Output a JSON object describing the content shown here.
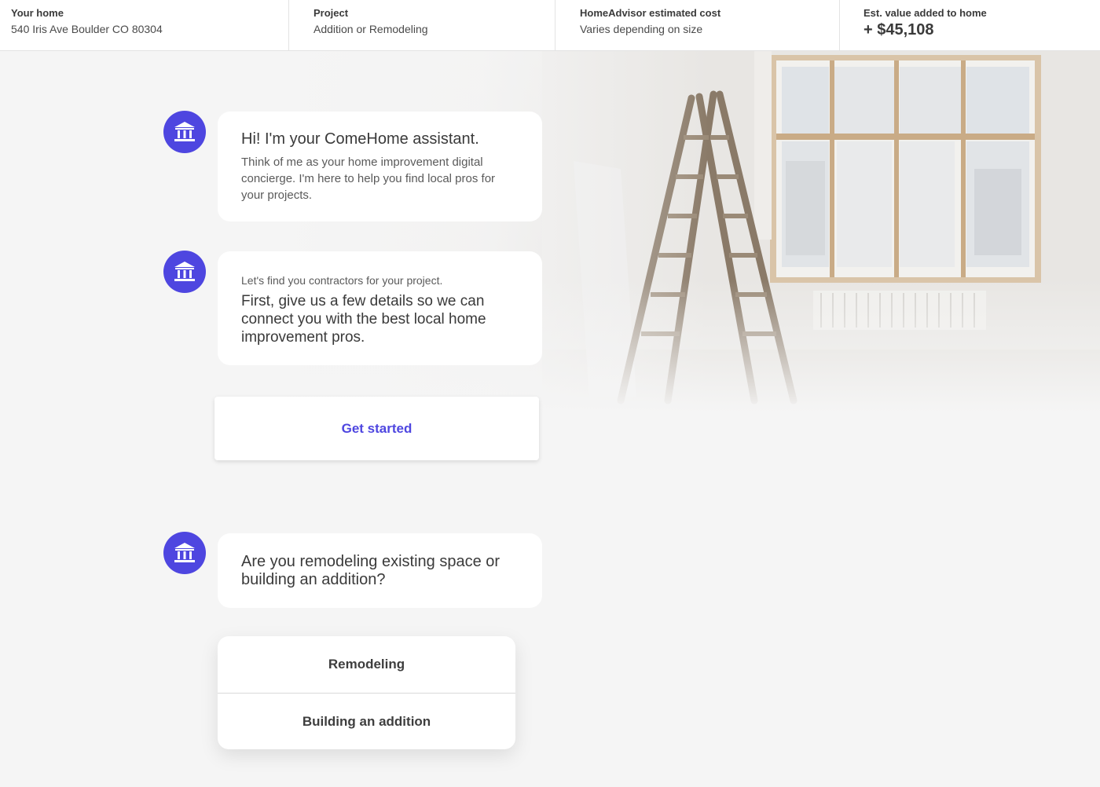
{
  "summary": {
    "home_label": "Your home",
    "home_value": "540 Iris Ave Boulder CO 80304",
    "project_label": "Project",
    "project_value": "Addition or Remodeling",
    "cost_label": "HomeAdvisor estimated cost",
    "cost_value": "Varies depending on size",
    "value_label": "Est. value added to home",
    "value_value": "+ $45,108"
  },
  "assistant": {
    "avatar_icon": "bank-building-icon",
    "accent_color": "#4e46e0"
  },
  "messages": {
    "greeting_title": "Hi! I'm your ComeHome assistant.",
    "greeting_body": "Think of me as your home improvement digital concierge. I'm here to help you find local pros for your projects.",
    "intro_small": "Let's find you contractors for your project.",
    "intro_main": "First, give us a few details so we can connect you with the best local home improvement pros.",
    "question": "Are you remodeling existing space or building an addition?"
  },
  "actions": {
    "get_started": "Get started",
    "choices": [
      "Remodeling",
      "Building an addition"
    ]
  }
}
